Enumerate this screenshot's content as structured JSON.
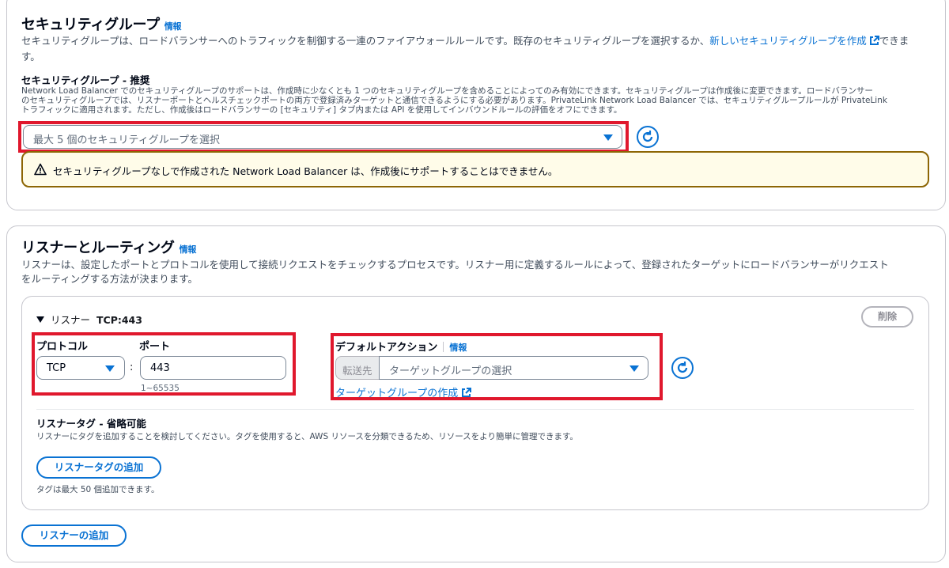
{
  "security_group": {
    "title": "セキュリティグループ",
    "info": "情報",
    "description_pre": "セキュリティグループは、ロードバランサーへのトラフィックを制御する一連のファイアウォールルールです。既存のセキュリティグループを選択するか、",
    "description_link": "新しいセキュリティグループを作成",
    "description_post": "できま",
    "description_wrap": "す。",
    "field_label": "セキュリティグループ - 推奨",
    "field_help_1": "Network Load Balancer でのセキュリティグループのサポートは、作成時に少なくとも 1 つのセキュリティグループを含めることによってのみ有効にできます。セキュリティグループは作成後に変更できます。ロードバランサー",
    "field_help_2": "のセキュリティグループでは、リスナーポートとヘルスチェックポートの両方で登録済みターゲットと通信できるようにする必要があります。PrivateLink Network Load Balancer では、セキュリティグループルールが PrivateLink",
    "field_help_3": "トラフィックに適用されます。ただし、作成後はロードバランサーの [セキュリティ] タブ内または API を使用してインバウンドルールの評価をオフにできます。",
    "select_placeholder": "最大 5 個のセキュリティグループを選択",
    "warning": "セキュリティグループなしで作成された Network Load Balancer は、作成後にサポートすることはできません。"
  },
  "listeners": {
    "title": "リスナーとルーティング",
    "info": "情報",
    "description_1": "リスナーは、設定したポートとプロトコルを使用して接続リクエストをチェックするプロセスです。リスナー用に定義するルールによって、登録されたターゲットにロードバランサーがリクエスト",
    "description_2": "をルーティングする方法が決まります。",
    "listener": {
      "header_label": "リスナー",
      "header_value": "TCP:443",
      "remove_button": "削除",
      "protocol_label": "プロトコル",
      "protocol_value": "TCP",
      "colon": ":",
      "port_label": "ポート",
      "port_value": "443",
      "port_hint": "1~65535",
      "default_action_label": "デフォルトアクション",
      "default_action_info": "情報",
      "forward_label": "転送先",
      "target_group_placeholder": "ターゲットグループの選択",
      "create_target_group_link": "ターゲットグループの作成",
      "tags_title": "リスナータグ - 省略可能",
      "tags_description": "リスナーにタグを追加することを検討してください。タグを使用すると、AWS リソースを分類できるため、リソースをより簡単に管理できます。",
      "add_tag_button": "リスナータグの追加",
      "tags_limit": "タグは最大 50 個追加できます。"
    },
    "add_listener_button": "リスナーの追加"
  },
  "colors": {
    "link": "#0972d3",
    "highlight": "#e0182d",
    "warning_border": "#8d6605",
    "warning_bg": "#fffce9"
  },
  "icons": [
    "caret-down-icon",
    "refresh-icon",
    "external-link-icon",
    "warning-icon",
    "expand-triangle-icon"
  ]
}
